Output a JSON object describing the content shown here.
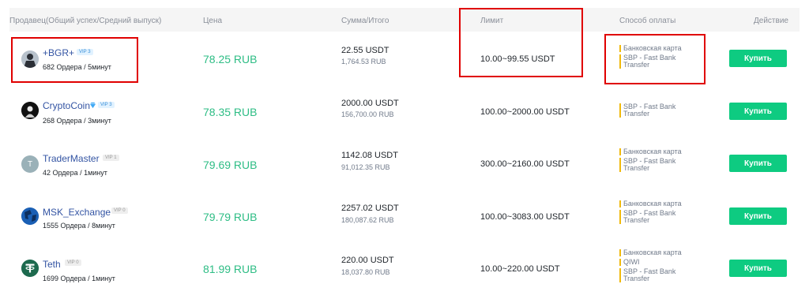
{
  "headers": {
    "seller": "Продавец(Общий успех/Средний выпуск)",
    "price": "Цена",
    "amount": "Сумма/Итого",
    "limit": "Лимит",
    "payment": "Способ оплаты",
    "action": "Действие"
  },
  "buy_label": "Купить",
  "rows": [
    {
      "name": "+BGR+",
      "level": "VIP 3",
      "stats": "682 Ордера / 5минут",
      "price": "78.25 RUB",
      "amount": "22.55 USDT",
      "total": "1,764.53 RUB",
      "limit": "10.00~99.55 USDT",
      "payments": [
        "Банковская карта",
        "SBP - Fast Bank",
        "Transfer"
      ]
    },
    {
      "name": "CryptoCoin",
      "level": "VIP 3",
      "stats": "268 Ордера / 3минут",
      "price": "78.35 RUB",
      "amount": "2000.00 USDT",
      "total": "156,700.00 RUB",
      "limit": "100.00~2000.00 USDT",
      "payments": [
        "SBP - Fast Bank",
        "Transfer"
      ]
    },
    {
      "name": "TraderMaster",
      "avatar_letter": "T",
      "level": "VIP 1",
      "stats": "42 Ордера / 1минут",
      "price": "79.69 RUB",
      "amount": "1142.08 USDT",
      "total": "91,012.35 RUB",
      "limit": "300.00~2160.00 USDT",
      "payments": [
        "Банковская карта",
        "SBP - Fast Bank",
        "Transfer"
      ]
    },
    {
      "name": "MSK_Exchange",
      "level": "VIP 0",
      "stats": "1555 Ордера / 8минут",
      "price": "79.79 RUB",
      "amount": "2257.02 USDT",
      "total": "180,087.62 RUB",
      "limit": "100.00~3083.00 USDT",
      "payments": [
        "Банковская карта",
        "SBP - Fast Bank",
        "Transfer"
      ]
    },
    {
      "name": "Teth",
      "avatar_letter": "T",
      "level": "VIP 0",
      "stats": "1699 Ордера / 1минут",
      "price": "81.99 RUB",
      "amount": "220.00 USDT",
      "total": "18,037.80 RUB",
      "limit": "10.00~220.00 USDT",
      "payments": [
        "Банковская карта",
        "QIWI",
        "SBP - Fast Bank",
        "Transfer"
      ]
    }
  ],
  "colors": {
    "price_green": "#2ebd85",
    "button_green": "#0ecb81",
    "seller_blue": "#3354a3",
    "payment_bar": "#f0b90b",
    "highlight_red": "#e00000"
  }
}
